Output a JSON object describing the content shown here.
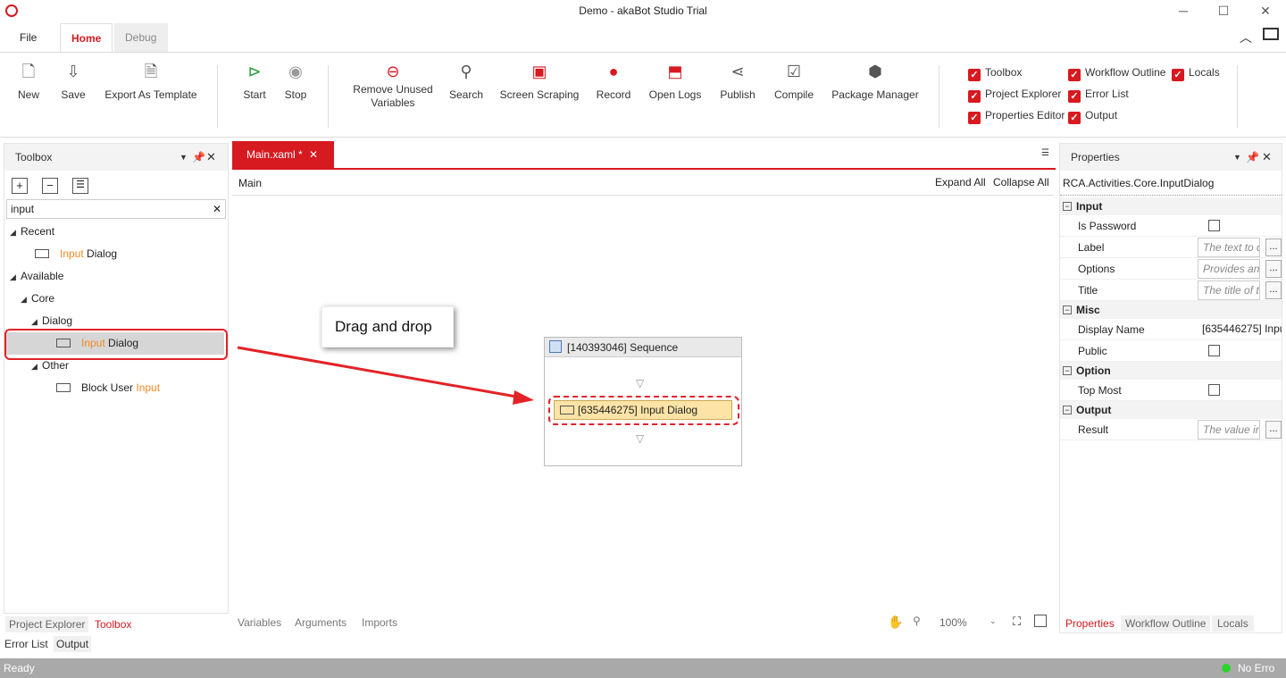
{
  "window": {
    "title": "Demo - akaBot Studio Trial",
    "minimize": "─",
    "maximize": "☐",
    "close": "✕"
  },
  "ribbon_tabs": {
    "file": "File",
    "home": "Home",
    "debug": "Debug"
  },
  "ribbon": {
    "new": "New",
    "save": "Save",
    "export": "Export As Template",
    "start": "Start",
    "stop": "Stop",
    "remove_unused": "Remove Unused Variables",
    "search": "Search",
    "screen_scraping": "Screen Scraping",
    "record": "Record",
    "open_logs": "Open Logs",
    "publish": "Publish",
    "compile": "Compile",
    "package_manager": "Package Manager"
  },
  "panels_checks": {
    "toolbox": "Toolbox",
    "workflow_outline": "Workflow Outline",
    "locals": "Locals",
    "project_explorer": "Project Explorer",
    "error_list": "Error List",
    "properties_editor": "Properties Editor",
    "output": "Output"
  },
  "toolbox": {
    "title": "Toolbox",
    "search_value": "input",
    "recent": "Recent",
    "recent_item_hl": "Input",
    "recent_item_rest": " Dialog",
    "available": "Available",
    "core": "Core",
    "dialog": "Dialog",
    "dialog_item_hl": "Input",
    "dialog_item_rest": " Dialog",
    "other": "Other",
    "other_item_rest": "Block User ",
    "other_item_hl": "Input"
  },
  "left_bottom_tabs": {
    "project_explorer": "Project Explorer",
    "toolbox": "Toolbox"
  },
  "bottom_tabs": {
    "error_list": "Error List",
    "output": "Output"
  },
  "designer": {
    "tab": "Main.xaml *",
    "breadcrumb": "Main",
    "expand_all": "Expand All",
    "collapse_all": "Collapse All",
    "sequence_title": "[140393046] Sequence",
    "activity_title": "[635446275] Input Dialog",
    "callout": "Drag and drop",
    "bottom_variables": "Variables",
    "bottom_arguments": "Arguments",
    "bottom_imports": "Imports",
    "zoom": "100%"
  },
  "properties": {
    "title": "Properties",
    "type": "RCA.Activities.Core.InputDialog",
    "cat_input": "Input",
    "is_password": "Is Password",
    "label": "Label",
    "label_ph": "The text to d",
    "options": "Options",
    "options_ph": "Provides an",
    "title_prop": "Title",
    "title_ph": "The title of t",
    "cat_misc": "Misc",
    "display_name": "Display Name",
    "display_name_val": "[635446275] Inpu",
    "public": "Public",
    "cat_option": "Option",
    "top_most": "Top Most",
    "cat_output": "Output",
    "result": "Result",
    "result_ph": "The value in",
    "ellipsis": "..."
  },
  "right_bottom_tabs": {
    "properties": "Properties",
    "workflow_outline": "Workflow Outline",
    "locals": "Locals"
  },
  "status": {
    "left": "Ready",
    "right": "No Erro"
  },
  "colors": {
    "accent": "#d71920",
    "highlight": "#f08a24",
    "activity_fill": "#fde4a6",
    "status_bar": "#a9a9a9"
  }
}
